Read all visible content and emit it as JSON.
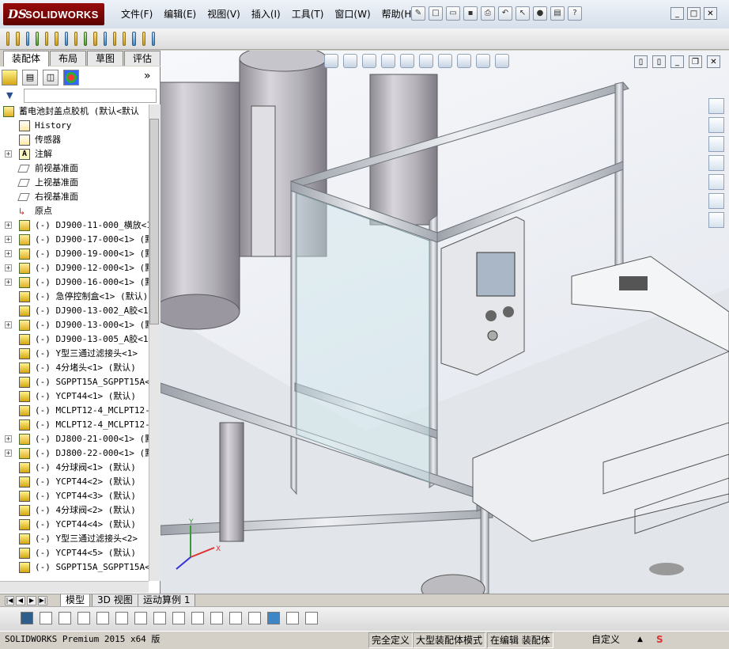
{
  "app": {
    "logo_ds": "DS",
    "logo_text": "SOLIDWORKS"
  },
  "menu": [
    "文件(F)",
    "编辑(E)",
    "视图(V)",
    "插入(I)",
    "工具(T)",
    "窗口(W)",
    "帮助(H)"
  ],
  "command_tabs": [
    "装配体",
    "布局",
    "草图",
    "评估"
  ],
  "feature_tree": {
    "root": "蓄电池封盖点胶机 (默认<默认",
    "items": [
      {
        "label": "History",
        "icon": "history-icon",
        "expand": false
      },
      {
        "label": "传感器",
        "icon": "sensor-icon",
        "expand": false
      },
      {
        "label": "注解",
        "icon": "annotation-icon",
        "expand": true
      },
      {
        "label": "前视基准面",
        "icon": "plane-icon",
        "expand": false
      },
      {
        "label": "上视基准面",
        "icon": "plane-icon",
        "expand": false
      },
      {
        "label": "右视基准面",
        "icon": "plane-icon",
        "expand": false
      },
      {
        "label": "原点",
        "icon": "origin-icon",
        "expand": false
      },
      {
        "label": "(-) DJ900-11-000_横放<1>",
        "icon": "subassembly-icon",
        "expand": true
      },
      {
        "label": "(-) DJ900-17-000<1> (默认",
        "icon": "subassembly-icon",
        "expand": true
      },
      {
        "label": "(-) DJ900-19-000<1> (默认",
        "icon": "subassembly-icon",
        "expand": true
      },
      {
        "label": "(-) DJ900-12-000<1> (默认",
        "icon": "subassembly-icon",
        "expand": true
      },
      {
        "label": "(-) DJ900-16-000<1> (默认",
        "icon": "subassembly-icon",
        "expand": true
      },
      {
        "label": "(-) 急停控制盒<1> (默认)",
        "icon": "part-icon",
        "expand": false
      },
      {
        "label": "(-) DJ900-13-002_A胶<1>",
        "icon": "part-icon",
        "expand": false
      },
      {
        "label": "(-) DJ900-13-000<1> (默认",
        "icon": "subassembly-icon",
        "expand": true
      },
      {
        "label": "(-) DJ900-13-005_A胶<1>",
        "icon": "part-icon",
        "expand": false
      },
      {
        "label": "(-) Y型三通过滤接头<1>",
        "icon": "part-icon",
        "expand": false
      },
      {
        "label": "(-) 4分堵头<1> (默认)",
        "icon": "part-icon",
        "expand": false
      },
      {
        "label": "(-) SGPPT15A_SGPPT15A<1>",
        "icon": "part-icon",
        "expand": false
      },
      {
        "label": "(-) YCPT44<1> (默认)",
        "icon": "part-icon",
        "expand": false
      },
      {
        "label": "(-) MCLPT12-4_MCLPT12-4<",
        "icon": "part-icon",
        "expand": false
      },
      {
        "label": "(-) MCLPT12-4_MCLPT12-4<",
        "icon": "part-icon",
        "expand": false
      },
      {
        "label": "(-) DJ800-21-000<1> (默认",
        "icon": "subassembly-icon",
        "expand": true
      },
      {
        "label": "(-) DJ800-22-000<1> (默认",
        "icon": "subassembly-icon",
        "expand": true
      },
      {
        "label": "(-) 4分球阀<1> (默认)",
        "icon": "part-icon",
        "expand": false
      },
      {
        "label": "(-) YCPT44<2> (默认)",
        "icon": "part-icon",
        "expand": false
      },
      {
        "label": "(-) YCPT44<3> (默认)",
        "icon": "part-icon",
        "expand": false
      },
      {
        "label": "(-) 4分球阀<2> (默认)",
        "icon": "part-icon",
        "expand": false
      },
      {
        "label": "(-) YCPT44<4> (默认)",
        "icon": "part-icon",
        "expand": false
      },
      {
        "label": "(-) Y型三通过滤接头<2>",
        "icon": "part-icon",
        "expand": false
      },
      {
        "label": "(-) YCPT44<5> (默认)",
        "icon": "part-icon",
        "expand": false
      },
      {
        "label": "(-) SGPPT15A_SGPPT15A<2>",
        "icon": "part-icon",
        "expand": false
      }
    ]
  },
  "bottom_tabs": [
    "模型",
    "3D 视图",
    "运动算例 1"
  ],
  "status": {
    "product": "SOLIDWORKS Premium 2015 x64 版",
    "fully_defined": "完全定义",
    "mode": "大型装配体模式",
    "editing": "在编辑 装配体",
    "custom": "自定义"
  },
  "colors": {
    "frame": "#b9bdc4",
    "tank": "#b5b2b8",
    "glass": "#cfe6ea",
    "logo": "#8a0808"
  }
}
